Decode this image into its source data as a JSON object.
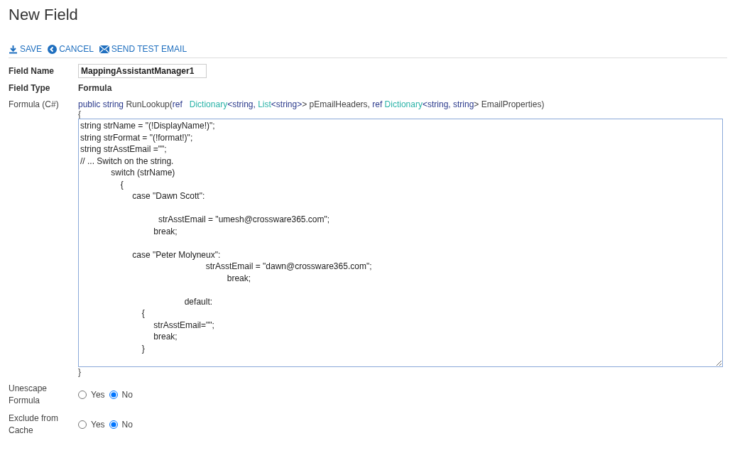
{
  "page_title": "New Field",
  "toolbar": [
    {
      "kind": "save",
      "label": "SAVE"
    },
    {
      "kind": "cancel",
      "label": "CANCEL"
    },
    {
      "kind": "email",
      "label": "SEND TEST EMAIL"
    }
  ],
  "field_name": {
    "label": "Field Name",
    "value": "MappingAssistantManager1"
  },
  "field_type": {
    "label": "Field Type",
    "value": "Formula"
  },
  "formula": {
    "label": "Formula (C#)",
    "signature": [
      {
        "kind": "keyword",
        "text": "public string "
      },
      {
        "kind": "plain",
        "text": "RunLookup("
      },
      {
        "kind": "keyword",
        "text": "ref   "
      },
      {
        "kind": "type",
        "text": "Dictionary"
      },
      {
        "kind": "keyword",
        "text": "<string, "
      },
      {
        "kind": "type",
        "text": "List"
      },
      {
        "kind": "keyword",
        "text": "<string>"
      },
      {
        "kind": "plain",
        "text": "> pEmailHeaders, "
      },
      {
        "kind": "keyword",
        "text": "ref "
      },
      {
        "kind": "type",
        "text": "Dictionary"
      },
      {
        "kind": "keyword",
        "text": "<string, string"
      },
      {
        "kind": "plain",
        "text": "> EmailProperties)"
      }
    ],
    "open_brace": "{",
    "code_blocks": [
      [
        "string strName = \"(!DisplayName!)\";",
        "string strFormat = \"(!format!)\";",
        "string strAsstEmail =\"\";",
        "// ... Switch on the string.",
        "             switch (strName)",
        "                 {",
        "                      case \"Dawn Scott\":"
      ],
      [
        "                                 strAsstEmail = \"umesh@crossware365.com\";",
        "                               break;"
      ],
      [
        "                      case \"Peter Molyneux\":",
        "                                                     strAsstEmail = \"dawn@crossware365.com\";",
        "                                                              break;"
      ],
      [
        "                                            default:",
        "                          {",
        "                               strAsstEmail=\"\";",
        "                               break;",
        "                          }"
      ]
    ],
    "close_brace": "}"
  },
  "options": [
    {
      "label": "Unescape Formula",
      "choices": [
        {
          "label": "Yes",
          "selected": false
        },
        {
          "label": "No",
          "selected": true
        }
      ]
    },
    {
      "label": "Exclude from Cache",
      "choices": [
        {
          "label": "Yes",
          "selected": false
        },
        {
          "label": "No",
          "selected": true
        }
      ]
    }
  ]
}
